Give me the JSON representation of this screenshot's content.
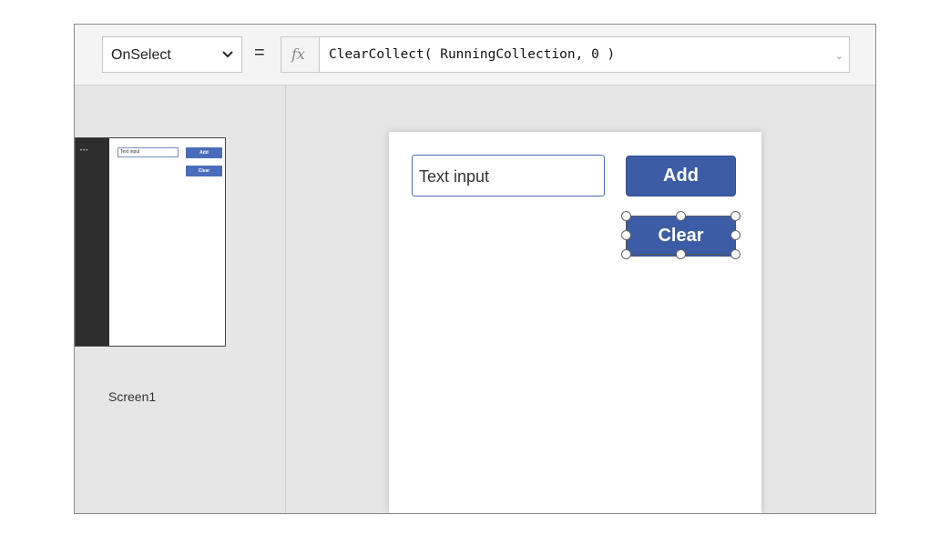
{
  "formula_bar": {
    "property": "OnSelect",
    "equals": "=",
    "fx": "fx",
    "formula": "ClearCollect( RunningCollection, 0 )",
    "expand_glyph": "⌄"
  },
  "screens_panel": {
    "thumbnail": {
      "dots": "•••",
      "text_input": "Text input",
      "add_label": "Add",
      "clear_label": "Clear"
    },
    "screen_name": "Screen1"
  },
  "app_canvas": {
    "text_input": "Text input",
    "add_button": "Add",
    "clear_button": "Clear",
    "selected_control": "Clear"
  },
  "colors": {
    "button": "#3c5ca6",
    "canvas_bg": "#e6e6e6",
    "thumbnail_sidebar": "#2d2d2d"
  }
}
